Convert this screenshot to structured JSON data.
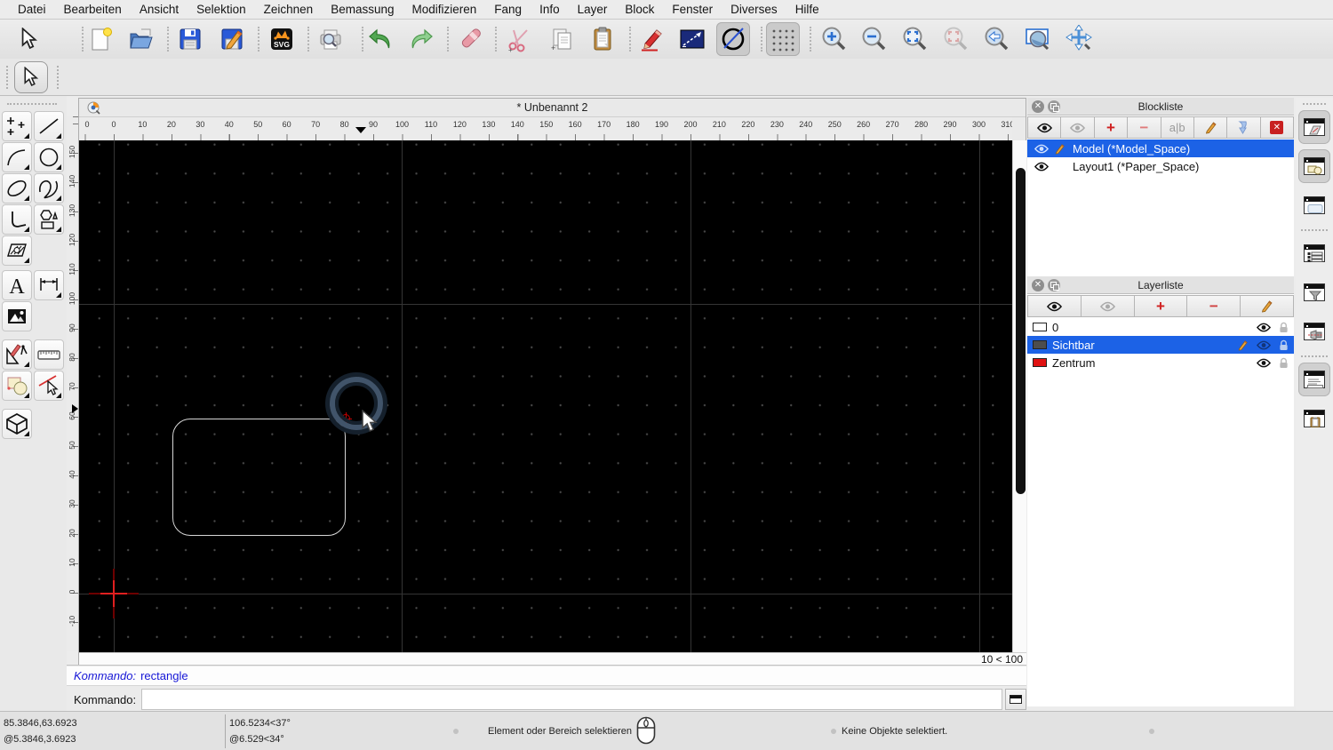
{
  "menubar": {
    "items": [
      "Datei",
      "Bearbeiten",
      "Ansicht",
      "Selektion",
      "Zeichnen",
      "Bemassung",
      "Modifizieren",
      "Fang",
      "Info",
      "Layer",
      "Block",
      "Fenster",
      "Diverses",
      "Hilfe"
    ]
  },
  "main_toolbar": {
    "icons": [
      "selection-arrow",
      "new-document",
      "open-file",
      "save",
      "save-as",
      "svg-export",
      "print-preview",
      "undo",
      "redo",
      "eraser",
      "cut",
      "copy",
      "paste",
      "edit-pencil",
      "line-box",
      "circle-line",
      "grid-toggle",
      "zoom-in",
      "zoom-out",
      "zoom-auto",
      "zoom-selected",
      "zoom-previous",
      "zoom-window",
      "zoom-pan"
    ]
  },
  "tool_options": {
    "icons": [
      "selection-arrow"
    ]
  },
  "tool_palette": {
    "icons": [
      "points",
      "line",
      "arc",
      "circle",
      "ellipse",
      "spline",
      "polyline",
      "shapes",
      "hatch",
      "text",
      "dimension",
      "image",
      "construction",
      "measure",
      "order",
      "properties",
      "cube"
    ]
  },
  "document": {
    "title": "* Unbenannt 2",
    "grid_status": "10 < 100"
  },
  "rulers": {
    "horizontal": [
      "0",
      "0",
      "10",
      "20",
      "30",
      "40",
      "50",
      "60",
      "70",
      "80",
      "90",
      "100",
      "110",
      "120",
      "130",
      "140",
      "150",
      "160",
      "170",
      "180",
      "190",
      "200",
      "210",
      "220",
      "230",
      "240",
      "250",
      "260",
      "270",
      "280",
      "290",
      "300",
      "310"
    ],
    "vertical": [
      "150",
      "140",
      "130",
      "120",
      "110",
      "100",
      "90",
      "80",
      "70",
      "60",
      "50",
      "40",
      "30",
      "20",
      "10",
      "0",
      "-10"
    ]
  },
  "blocklist": {
    "title": "Blockliste",
    "toolbar_icons": [
      "show-all-blocks",
      "hide-all-blocks",
      "add-block",
      "remove-block",
      "rename-block",
      "edit-block",
      "insert-block",
      "delete-block"
    ],
    "rename_glyph": "a|b",
    "items": [
      {
        "label": "Model (*Model_Space)",
        "selected": true,
        "pencil": true
      },
      {
        "label": "Layout1 (*Paper_Space)",
        "selected": false,
        "pencil": false
      }
    ]
  },
  "layerlist": {
    "title": "Layerliste",
    "toolbar_icons": [
      "show-all-layers",
      "hide-all-layers",
      "add-layer",
      "remove-layer",
      "edit-layer"
    ],
    "items": [
      {
        "label": "0",
        "color": "#ffffff",
        "selected": false,
        "pencil": false
      },
      {
        "label": "Sichtbar",
        "color": "#4d4d4d",
        "selected": true,
        "pencil": true
      },
      {
        "label": "Zentrum",
        "color": "#e01212",
        "selected": false,
        "pencil": false
      }
    ]
  },
  "right_dock_toolbar": {
    "icons": [
      "dock-block-list",
      "dock-layer-list",
      "dock-library",
      "dock-entity-list",
      "dock-filter",
      "dock-render",
      "dock-command-line",
      "dock-clipboard"
    ]
  },
  "command": {
    "history_label": "Kommando:",
    "history_value": "rectangle",
    "input_label": "Kommando:",
    "input_value": ""
  },
  "statusbar": {
    "abs": "85.3846,63.6923",
    "rel": "@5.3846,3.6923",
    "polar_abs": "106.5234<37°",
    "polar_rel": "@6.529<34°",
    "hint": "Element oder Bereich selektieren",
    "selection_info": "Keine Objekte selektiert."
  },
  "colors": {
    "selection_blue": "#1c62e6",
    "canvas_bg": "#000000",
    "crosshair_red": "#e02020",
    "layer_red": "#e01212"
  }
}
